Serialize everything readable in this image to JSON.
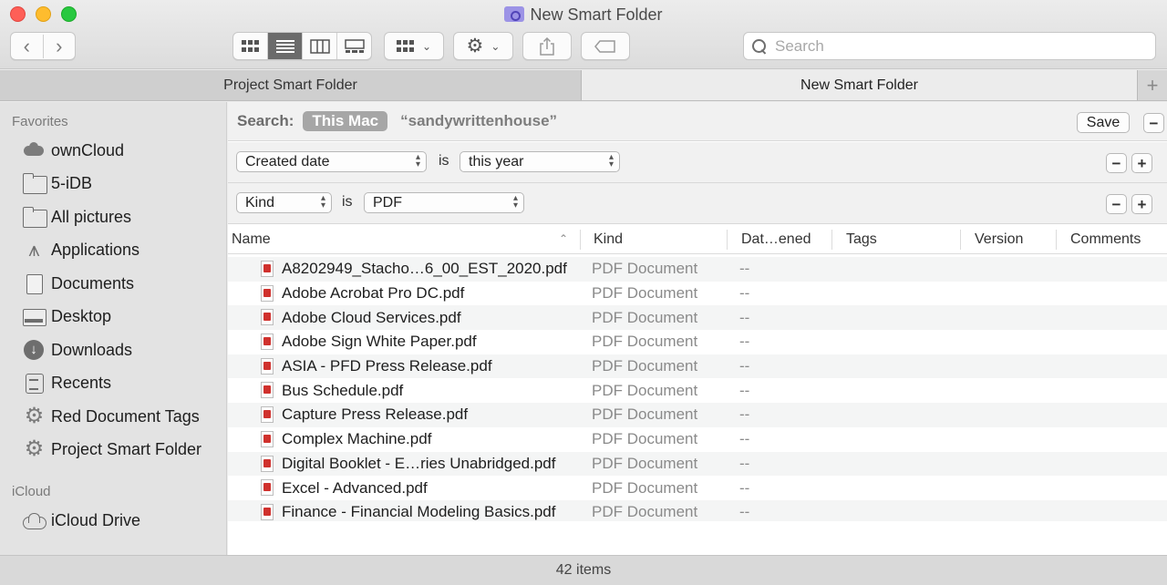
{
  "window": {
    "title": "New Smart Folder"
  },
  "toolbar": {
    "back_icon": "chevron-left-icon",
    "forward_icon": "chevron-right-icon",
    "view_modes": [
      "icon-view",
      "list-view",
      "column-view",
      "gallery-view"
    ],
    "active_view": "list-view",
    "search_placeholder": "Search"
  },
  "tabs": [
    {
      "label": "Project Smart Folder",
      "active": false
    },
    {
      "label": "New Smart Folder",
      "active": true
    }
  ],
  "sidebar": {
    "favorites_heading": "Favorites",
    "favorites": [
      {
        "label": "ownCloud",
        "icon": "cloud-icon"
      },
      {
        "label": "5-iDB",
        "icon": "folder-icon"
      },
      {
        "label": "All pictures",
        "icon": "folder-icon"
      },
      {
        "label": "Applications",
        "icon": "applications-icon"
      },
      {
        "label": "Documents",
        "icon": "document-icon"
      },
      {
        "label": "Desktop",
        "icon": "desktop-icon"
      },
      {
        "label": "Downloads",
        "icon": "download-icon"
      },
      {
        "label": "Recents",
        "icon": "recents-icon"
      },
      {
        "label": "Red Document Tags",
        "icon": "gear-icon"
      },
      {
        "label": "Project Smart Folder",
        "icon": "gear-icon"
      }
    ],
    "icloud_heading": "iCloud",
    "icloud": [
      {
        "label": "iCloud Drive",
        "icon": "icloud-icon"
      }
    ]
  },
  "search": {
    "label": "Search:",
    "scope_active": "This Mac",
    "scope_other": "“sandywrittenhouse”",
    "save_label": "Save",
    "minus": "−"
  },
  "rules": [
    {
      "attribute": "Created date",
      "operator": "is",
      "value": "this year",
      "minus": "−",
      "plus": "+"
    },
    {
      "attribute": "Kind",
      "operator": "is",
      "value": "PDF",
      "minus": "−",
      "plus": "+"
    }
  ],
  "columns": {
    "name": "Name",
    "kind": "Kind",
    "date": "Dat…ened",
    "tags": "Tags",
    "version": "Version",
    "comments": "Comments"
  },
  "files": [
    {
      "name": "A8202949_Stacho…6_00_EST_2020.pdf",
      "kind": "PDF Document",
      "date": "--"
    },
    {
      "name": "Adobe Acrobat Pro DC.pdf",
      "kind": "PDF Document",
      "date": "--"
    },
    {
      "name": "Adobe Cloud Services.pdf",
      "kind": "PDF Document",
      "date": "--"
    },
    {
      "name": "Adobe Sign White Paper.pdf",
      "kind": "PDF Document",
      "date": "--"
    },
    {
      "name": "ASIA - PFD Press Release.pdf",
      "kind": "PDF Document",
      "date": "--"
    },
    {
      "name": "Bus Schedule.pdf",
      "kind": "PDF Document",
      "date": "--"
    },
    {
      "name": "Capture Press Release.pdf",
      "kind": "PDF Document",
      "date": "--"
    },
    {
      "name": "Complex Machine.pdf",
      "kind": "PDF Document",
      "date": "--"
    },
    {
      "name": "Digital Booklet - E…ries Unabridged.pdf",
      "kind": "PDF Document",
      "date": "--"
    },
    {
      "name": "Excel - Advanced.pdf",
      "kind": "PDF Document",
      "date": "--"
    },
    {
      "name": "Finance - Financial Modeling Basics.pdf",
      "kind": "PDF Document",
      "date": "--"
    }
  ],
  "status": {
    "item_count": "42 items"
  }
}
